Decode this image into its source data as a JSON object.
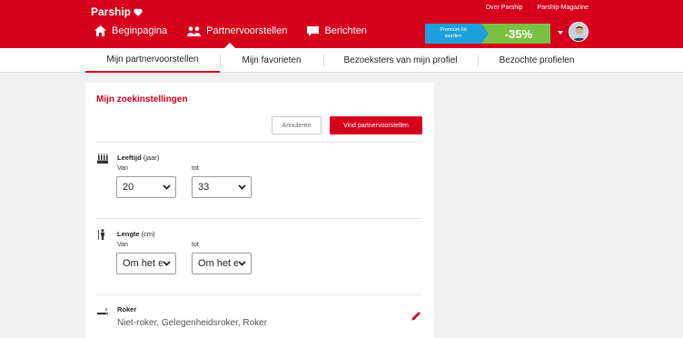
{
  "header": {
    "logo_text": "Parship",
    "top_links": [
      "Over Parship",
      "Parship-Magazine"
    ],
    "nav": [
      {
        "label": "Beginpagina",
        "icon": "home-icon"
      },
      {
        "label": "Partnervoorstellen",
        "icon": "people-icon"
      },
      {
        "label": "Berichten",
        "icon": "chat-bubble-icon"
      }
    ],
    "promo": {
      "line1": "Premium-lid",
      "line2": "worden",
      "discount": "-35%"
    }
  },
  "subnav": {
    "tabs": [
      "Mijn partnervoorstellen",
      "Mijn favorieten",
      "Bezoeksters van mijn profiel",
      "Bezochte profielen"
    ],
    "active": "Mijn partnervoorstellen"
  },
  "search_settings": {
    "title": "Mijn zoekinstellingen",
    "cancel_label": "Annuleren",
    "find_label": "Vind partnervoorstellen",
    "age": {
      "title": "Leeftijd",
      "unit": "(jaar)",
      "from_label": "Van",
      "to_label": "tot",
      "from_value": "20",
      "to_value": "33"
    },
    "height": {
      "title": "Lengte",
      "unit": "(cm)",
      "from_label": "Van",
      "to_label": "tot",
      "from_value": "Om het e",
      "to_value": "Om het e"
    },
    "smoker": {
      "title": "Roker",
      "value": "Niet-roker, Gelegenheidsroker, Roker"
    }
  },
  "colors": {
    "brand": "#d6001c",
    "promo_blue": "#1d9fd9",
    "promo_green": "#7ac143"
  }
}
